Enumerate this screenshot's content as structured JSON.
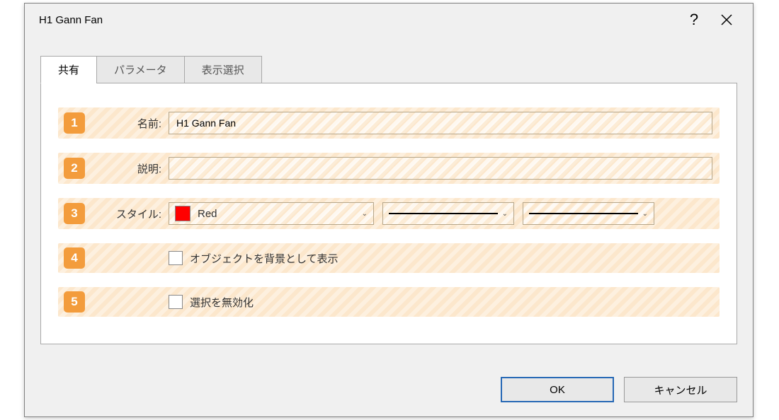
{
  "dialog": {
    "title": "H1 Gann Fan"
  },
  "tabs": {
    "0": {
      "label": "共有"
    },
    "1": {
      "label": "パラメータ"
    },
    "2": {
      "label": "表示選択"
    }
  },
  "rows": {
    "1": {
      "num": "1",
      "label": "名前:",
      "value": "H1 Gann Fan"
    },
    "2": {
      "num": "2",
      "label": "説明:",
      "value": ""
    },
    "3": {
      "num": "3",
      "label": "スタイル:",
      "color_name": "Red",
      "color_hex": "#ff0000"
    },
    "4": {
      "num": "4",
      "checkbox_label": "オブジェクトを背景として表示"
    },
    "5": {
      "num": "5",
      "checkbox_label": "選択を無効化"
    }
  },
  "buttons": {
    "ok": "OK",
    "cancel": "キャンセル"
  }
}
